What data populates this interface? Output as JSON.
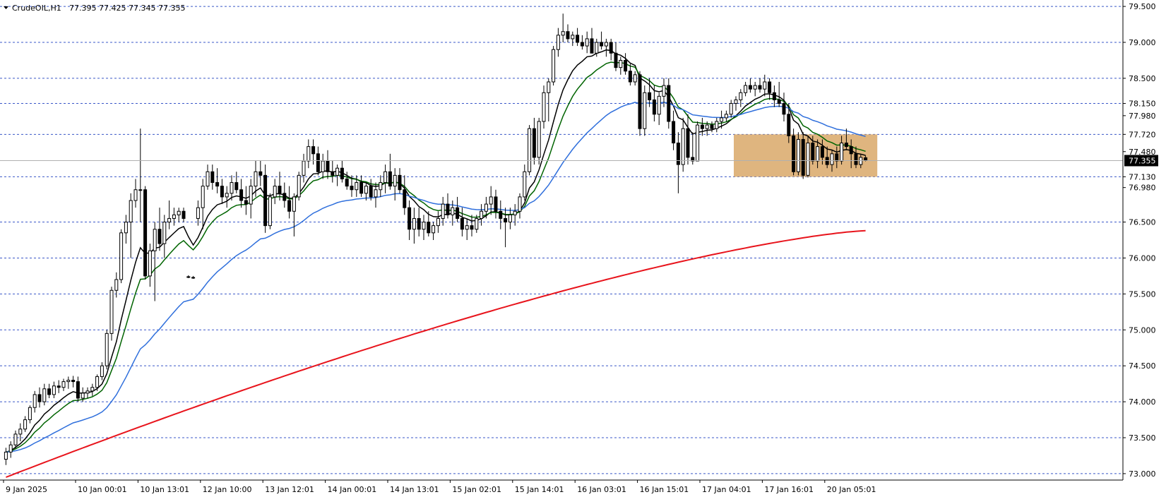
{
  "header": {
    "symbol": "CrudeOIL,H1",
    "ohlc": "77.395 77.425 77.345 77.355"
  },
  "colors": {
    "background": "#ffffff",
    "grid": "#3a57c8",
    "candle": "#000000",
    "ema_fast": "#000000",
    "ema_mid": "#006400",
    "ema_slow": "#2f6fdc",
    "sma_long": "#e8141c",
    "zone_fill": "#d9a868",
    "price_label_bg": "#000000"
  },
  "chart_data": {
    "type": "candlestick",
    "title": "CrudeOIL,H1",
    "ohlc_last": {
      "open": 77.395,
      "high": 77.425,
      "low": 77.345,
      "close": 77.355
    },
    "current_price": 77.355,
    "current_price_label": "77.355",
    "ylim": [
      72.95,
      79.55
    ],
    "y_ticks": [
      {
        "value": 79.5,
        "label": "79.500"
      },
      {
        "value": 79.0,
        "label": "79.000"
      },
      {
        "value": 78.5,
        "label": "78.500"
      },
      {
        "value": 78.15,
        "label": "78.150"
      },
      {
        "value": 77.98,
        "label": "77.980"
      },
      {
        "value": 77.72,
        "label": "77.720"
      },
      {
        "value": 77.48,
        "label": "77.480"
      },
      {
        "value": 77.13,
        "label": "77.130"
      },
      {
        "value": 76.98,
        "label": "76.980"
      },
      {
        "value": 76.5,
        "label": "76.500"
      },
      {
        "value": 76.0,
        "label": "76.000"
      },
      {
        "value": 75.5,
        "label": "75.500"
      },
      {
        "value": 75.0,
        "label": "75.000"
      },
      {
        "value": 74.5,
        "label": "74.500"
      },
      {
        "value": 74.0,
        "label": "74.000"
      },
      {
        "value": 73.5,
        "label": "73.500"
      },
      {
        "value": 73.0,
        "label": "73.000"
      }
    ],
    "dashed_levels": [
      79.5,
      79.0,
      78.5,
      78.15,
      77.72,
      77.13,
      76.5,
      76.0,
      75.5,
      75.0,
      74.5,
      74.0,
      73.5,
      73.0
    ],
    "x_labels": [
      {
        "index": 0,
        "label": "9 Jan 2025"
      },
      {
        "index": 15,
        "label": "10 Jan 00:01"
      },
      {
        "index": 28,
        "label": "10 Jan 13:01"
      },
      {
        "index": 41,
        "label": "12 Jan 10:00"
      },
      {
        "index": 54,
        "label": "13 Jan 12:01"
      },
      {
        "index": 67,
        "label": "14 Jan 00:01"
      },
      {
        "index": 80,
        "label": "14 Jan 13:01"
      },
      {
        "index": 93,
        "label": "15 Jan 02:01"
      },
      {
        "index": 106,
        "label": "15 Jan 14:01"
      },
      {
        "index": 119,
        "label": "16 Jan 03:01"
      },
      {
        "index": 132,
        "label": "16 Jan 15:01"
      },
      {
        "index": 145,
        "label": "17 Jan 04:01"
      },
      {
        "index": 158,
        "label": "17 Jan 16:01"
      },
      {
        "index": 171,
        "label": "20 Jan 05:01"
      }
    ],
    "zone": {
      "index_from": 152,
      "index_to": 181,
      "y_low": 77.13,
      "y_high": 77.72
    },
    "candles": [
      [
        73.2,
        73.36,
        73.12,
        73.3
      ],
      [
        73.3,
        73.45,
        73.22,
        73.4
      ],
      [
        73.4,
        73.6,
        73.35,
        73.55
      ],
      [
        73.55,
        73.7,
        73.45,
        73.62
      ],
      [
        73.62,
        73.8,
        73.58,
        73.75
      ],
      [
        73.75,
        73.95,
        73.7,
        73.92
      ],
      [
        73.92,
        74.15,
        73.85,
        74.1
      ],
      [
        74.1,
        74.2,
        73.92,
        74.0
      ],
      [
        74.0,
        74.25,
        73.95,
        74.18
      ],
      [
        74.18,
        74.25,
        74.05,
        74.1
      ],
      [
        74.1,
        74.28,
        74.05,
        74.22
      ],
      [
        74.22,
        74.3,
        74.12,
        74.2
      ],
      [
        74.2,
        74.32,
        74.15,
        74.28
      ],
      [
        74.28,
        74.35,
        74.18,
        74.3
      ],
      [
        74.3,
        74.36,
        74.2,
        74.28
      ],
      [
        74.28,
        74.35,
        74.0,
        74.05
      ],
      [
        74.05,
        74.2,
        74.0,
        74.12
      ],
      [
        74.12,
        74.2,
        74.05,
        74.15
      ],
      [
        74.15,
        74.25,
        74.08,
        74.2
      ],
      [
        74.2,
        74.38,
        74.15,
        74.35
      ],
      [
        74.35,
        74.55,
        74.3,
        74.5
      ],
      [
        74.5,
        75.0,
        74.45,
        74.95
      ],
      [
        74.95,
        75.6,
        74.85,
        75.55
      ],
      [
        75.55,
        75.8,
        75.45,
        75.7
      ],
      [
        75.7,
        76.4,
        75.65,
        76.35
      ],
      [
        76.35,
        76.6,
        76.2,
        76.5
      ],
      [
        76.5,
        76.9,
        76.0,
        76.8
      ],
      [
        76.8,
        77.1,
        76.7,
        76.95
      ],
      [
        76.95,
        77.8,
        76.5,
        76.95
      ],
      [
        76.95,
        77.0,
        75.7,
        75.75
      ],
      [
        75.75,
        76.2,
        75.6,
        76.1
      ],
      [
        76.1,
        76.5,
        75.4,
        76.4
      ],
      [
        76.4,
        76.7,
        76.1,
        76.2
      ],
      [
        76.2,
        76.6,
        76.0,
        76.5
      ],
      [
        76.5,
        76.8,
        76.4,
        76.55
      ],
      [
        76.55,
        76.7,
        76.45,
        76.6
      ],
      [
        76.6,
        76.7,
        76.5,
        76.65
      ],
      [
        76.65,
        76.7,
        76.5,
        76.55
      ],
      [
        75.74,
        75.76,
        75.72,
        75.73
      ],
      [
        75.73,
        75.75,
        75.71,
        75.72
      ],
      [
        76.55,
        76.8,
        76.45,
        76.7
      ],
      [
        76.7,
        77.1,
        76.4,
        77.0
      ],
      [
        77.0,
        77.3,
        76.95,
        77.2
      ],
      [
        77.2,
        77.3,
        76.95,
        77.05
      ],
      [
        77.05,
        77.25,
        76.9,
        77.0
      ],
      [
        77.0,
        77.1,
        76.75,
        76.85
      ],
      [
        76.85,
        77.0,
        76.7,
        76.9
      ],
      [
        76.9,
        77.15,
        76.8,
        77.05
      ],
      [
        77.05,
        77.2,
        76.9,
        76.95
      ],
      [
        76.95,
        77.1,
        76.7,
        76.8
      ],
      [
        76.8,
        77.0,
        76.6,
        76.75
      ],
      [
        76.75,
        77.1,
        76.55,
        77.0
      ],
      [
        77.0,
        77.35,
        76.85,
        77.2
      ],
      [
        77.2,
        77.35,
        77.0,
        77.15
      ],
      [
        77.15,
        77.3,
        76.35,
        76.45
      ],
      [
        76.45,
        76.9,
        76.4,
        76.85
      ],
      [
        76.85,
        77.1,
        76.75,
        77.0
      ],
      [
        77.0,
        77.2,
        76.8,
        76.9
      ],
      [
        76.9,
        77.05,
        76.7,
        76.8
      ],
      [
        76.8,
        77.0,
        76.55,
        76.65
      ],
      [
        76.65,
        76.9,
        76.3,
        76.85
      ],
      [
        76.85,
        77.2,
        76.8,
        77.15
      ],
      [
        77.15,
        77.45,
        77.05,
        77.35
      ],
      [
        77.35,
        77.65,
        77.25,
        77.55
      ],
      [
        77.55,
        77.65,
        77.3,
        77.45
      ],
      [
        77.45,
        77.55,
        77.15,
        77.2
      ],
      [
        77.2,
        77.45,
        77.1,
        77.35
      ],
      [
        77.35,
        77.5,
        77.1,
        77.2
      ],
      [
        77.2,
        77.35,
        77.05,
        77.15
      ],
      [
        77.15,
        77.3,
        77.0,
        77.25
      ],
      [
        77.25,
        77.35,
        77.05,
        77.1
      ],
      [
        77.1,
        77.2,
        76.95,
        77.0
      ],
      [
        77.0,
        77.15,
        76.85,
        76.95
      ],
      [
        76.95,
        77.15,
        76.85,
        77.05
      ],
      [
        77.05,
        77.15,
        76.85,
        76.9
      ],
      [
        76.9,
        77.05,
        76.8,
        77.0
      ],
      [
        77.0,
        77.1,
        76.8,
        76.85
      ],
      [
        76.85,
        77.05,
        76.7,
        76.95
      ],
      [
        76.95,
        77.15,
        76.85,
        77.05
      ],
      [
        77.05,
        77.3,
        76.9,
        77.2
      ],
      [
        77.2,
        77.45,
        76.95,
        77.0
      ],
      [
        77.0,
        77.25,
        76.8,
        77.15
      ],
      [
        77.15,
        77.25,
        76.9,
        76.95
      ],
      [
        76.95,
        77.15,
        76.6,
        76.7
      ],
      [
        76.7,
        76.8,
        76.25,
        76.4
      ],
      [
        76.4,
        76.7,
        76.2,
        76.55
      ],
      [
        76.55,
        76.7,
        76.3,
        76.4
      ],
      [
        76.4,
        76.6,
        76.25,
        76.5
      ],
      [
        76.5,
        76.65,
        76.3,
        76.35
      ],
      [
        76.35,
        76.5,
        76.25,
        76.45
      ],
      [
        76.45,
        76.65,
        76.35,
        76.55
      ],
      [
        76.55,
        76.85,
        76.45,
        76.75
      ],
      [
        76.75,
        76.9,
        76.55,
        76.6
      ],
      [
        76.6,
        76.8,
        76.45,
        76.7
      ],
      [
        76.7,
        76.85,
        76.5,
        76.55
      ],
      [
        76.55,
        76.7,
        76.3,
        76.4
      ],
      [
        76.4,
        76.55,
        76.25,
        76.45
      ],
      [
        76.45,
        76.6,
        76.3,
        76.4
      ],
      [
        76.4,
        76.6,
        76.35,
        76.55
      ],
      [
        76.55,
        76.75,
        76.45,
        76.65
      ],
      [
        76.65,
        76.85,
        76.55,
        76.75
      ],
      [
        76.75,
        77.0,
        76.6,
        76.85
      ],
      [
        76.85,
        76.95,
        76.55,
        76.65
      ],
      [
        76.65,
        76.8,
        76.4,
        76.55
      ],
      [
        76.55,
        76.7,
        76.15,
        76.5
      ],
      [
        76.5,
        76.7,
        76.4,
        76.6
      ],
      [
        76.6,
        76.75,
        76.45,
        76.65
      ],
      [
        76.65,
        76.9,
        76.55,
        76.85
      ],
      [
        76.85,
        77.3,
        76.8,
        77.2
      ],
      [
        77.2,
        77.85,
        77.15,
        77.8
      ],
      [
        77.8,
        77.95,
        77.3,
        77.4
      ],
      [
        77.4,
        77.95,
        77.3,
        77.9
      ],
      [
        77.9,
        78.4,
        77.8,
        78.3
      ],
      [
        78.3,
        78.5,
        77.9,
        78.45
      ],
      [
        78.45,
        78.95,
        78.4,
        78.9
      ],
      [
        78.9,
        79.2,
        78.8,
        79.1
      ],
      [
        79.1,
        79.4,
        79.0,
        79.15
      ],
      [
        79.15,
        79.25,
        79.0,
        79.05
      ],
      [
        79.05,
        79.15,
        78.95,
        79.1
      ],
      [
        79.1,
        79.2,
        78.95,
        79.0
      ],
      [
        79.0,
        79.1,
        78.9,
        78.95
      ],
      [
        78.95,
        79.15,
        78.85,
        79.05
      ],
      [
        79.05,
        79.2,
        78.85,
        78.85
      ],
      [
        78.85,
        79.05,
        78.8,
        79.0
      ],
      [
        79.0,
        79.15,
        78.9,
        78.95
      ],
      [
        78.95,
        79.05,
        78.8,
        79.0
      ],
      [
        79.0,
        79.05,
        78.75,
        78.85
      ],
      [
        78.85,
        79.0,
        78.6,
        78.65
      ],
      [
        78.65,
        78.8,
        78.55,
        78.75
      ],
      [
        78.75,
        78.85,
        78.55,
        78.6
      ],
      [
        78.6,
        78.7,
        78.4,
        78.45
      ],
      [
        78.45,
        78.6,
        78.4,
        78.55
      ],
      [
        78.55,
        78.6,
        77.7,
        77.8
      ],
      [
        77.8,
        78.4,
        77.7,
        78.3
      ],
      [
        78.3,
        78.5,
        78.1,
        78.2
      ],
      [
        78.2,
        78.4,
        77.9,
        78.0
      ],
      [
        78.0,
        78.3,
        77.85,
        78.25
      ],
      [
        78.25,
        78.5,
        78.1,
        78.4
      ],
      [
        78.4,
        78.5,
        77.8,
        77.9
      ],
      [
        77.9,
        78.05,
        77.5,
        77.6
      ],
      [
        77.6,
        77.75,
        76.9,
        77.3
      ],
      [
        77.3,
        77.95,
        77.2,
        77.8
      ],
      [
        77.8,
        78.0,
        77.3,
        77.4
      ],
      [
        77.4,
        77.75,
        77.3,
        77.35
      ],
      [
        77.35,
        77.9,
        77.35,
        77.85
      ],
      [
        77.85,
        77.95,
        77.7,
        77.8
      ],
      [
        77.8,
        77.9,
        77.7,
        77.85
      ],
      [
        77.85,
        77.9,
        77.75,
        77.8
      ],
      [
        77.8,
        77.95,
        77.75,
        77.9
      ],
      [
        77.9,
        78.05,
        77.8,
        77.95
      ],
      [
        77.95,
        78.05,
        77.9,
        78.0
      ],
      [
        78.0,
        78.2,
        77.95,
        78.15
      ],
      [
        78.15,
        78.25,
        78.05,
        78.2
      ],
      [
        78.2,
        78.35,
        78.1,
        78.3
      ],
      [
        78.3,
        78.45,
        78.25,
        78.4
      ],
      [
        78.4,
        78.5,
        78.3,
        78.35
      ],
      [
        78.35,
        78.45,
        78.25,
        78.4
      ],
      [
        78.4,
        78.5,
        78.3,
        78.35
      ],
      [
        78.35,
        78.55,
        78.25,
        78.45
      ],
      [
        78.45,
        78.5,
        78.2,
        78.3
      ],
      [
        78.3,
        78.4,
        78.1,
        78.2
      ],
      [
        78.2,
        78.45,
        78.1,
        78.15
      ],
      [
        78.15,
        78.3,
        77.9,
        78.0
      ],
      [
        78.0,
        78.15,
        77.6,
        77.7
      ],
      [
        77.7,
        77.8,
        77.15,
        77.2
      ],
      [
        77.2,
        77.75,
        77.15,
        77.65
      ],
      [
        77.65,
        77.75,
        77.1,
        77.15
      ],
      [
        77.15,
        77.7,
        77.12,
        77.6
      ],
      [
        77.6,
        77.7,
        77.3,
        77.35
      ],
      [
        77.35,
        77.65,
        77.25,
        77.55
      ],
      [
        77.55,
        77.65,
        77.3,
        77.4
      ],
      [
        77.4,
        77.55,
        77.25,
        77.3
      ],
      [
        77.3,
        77.5,
        77.2,
        77.45
      ],
      [
        77.45,
        77.55,
        77.25,
        77.35
      ],
      [
        77.35,
        77.7,
        77.3,
        77.6
      ],
      [
        77.6,
        77.8,
        77.5,
        77.55
      ],
      [
        77.55,
        77.65,
        77.25,
        77.45
      ],
      [
        77.45,
        77.55,
        77.25,
        77.3
      ],
      [
        77.3,
        77.45,
        77.25,
        77.4
      ],
      [
        77.395,
        77.425,
        77.345,
        77.355
      ]
    ],
    "moving_averages": [
      {
        "kind": "ema_fast",
        "period": 9
      },
      {
        "kind": "ema_mid",
        "period": 14
      },
      {
        "kind": "ema_slow",
        "period": 36
      },
      {
        "kind": "sma_long",
        "start_value": 72.95,
        "end_value": 76.38
      }
    ]
  }
}
